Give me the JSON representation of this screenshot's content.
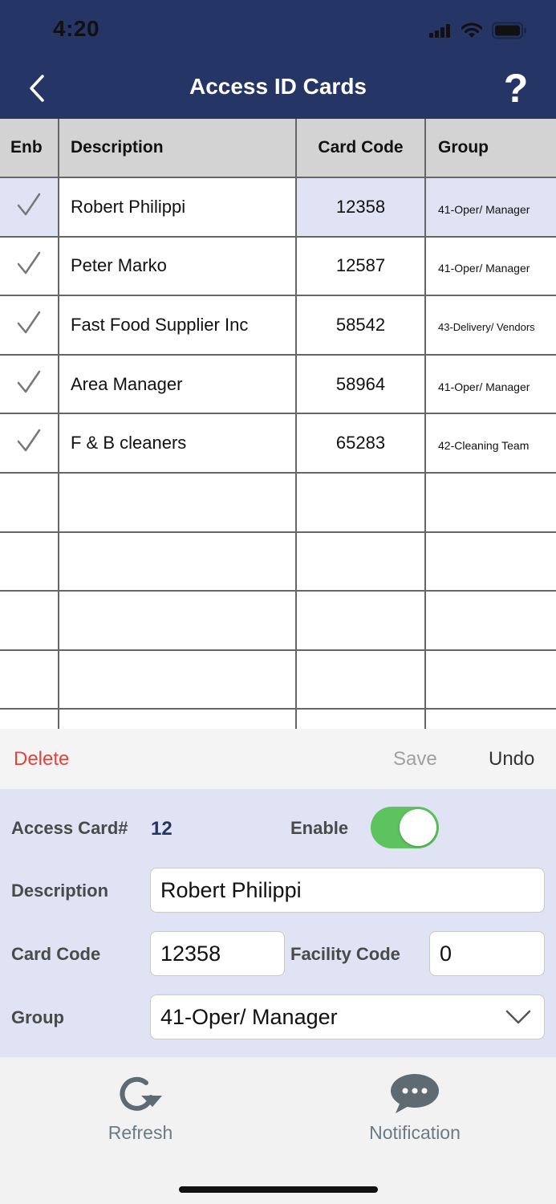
{
  "status_bar": {
    "time": "4:20"
  },
  "header": {
    "title": "Access ID Cards",
    "help_label": "?"
  },
  "table": {
    "columns": [
      "Enb",
      "Description",
      "Card Code",
      "Group"
    ],
    "rows": [
      {
        "enabled": "✓",
        "description": "Robert Philippi",
        "card_code": "12358",
        "group": "41-Oper/ Manager"
      },
      {
        "enabled": "✓",
        "description": "Peter Marko",
        "card_code": "12587",
        "group": "41-Oper/ Manager"
      },
      {
        "enabled": "✓",
        "description": "Fast Food Supplier Inc",
        "card_code": "58542",
        "group": "43-Delivery/ Vendors"
      },
      {
        "enabled": "✓",
        "description": "Area Manager",
        "card_code": "58964",
        "group": "41-Oper/ Manager"
      },
      {
        "enabled": "✓",
        "description": "F & B cleaners",
        "card_code": "65283",
        "group": "42-Cleaning Team"
      }
    ]
  },
  "actions": {
    "delete": "Delete",
    "save": "Save",
    "undo": "Undo"
  },
  "form": {
    "access_card_label": "Access Card#",
    "access_card_value": "12",
    "enable_label": "Enable",
    "enable_on": true,
    "description_label": "Description",
    "description_value": "Robert Philippi",
    "card_code_label": "Card Code",
    "card_code_value": "12358",
    "facility_code_label": "Facility Code",
    "facility_code_value": "0",
    "group_label": "Group",
    "group_value": "41-Oper/ Manager"
  },
  "tabbar": {
    "refresh": "Refresh",
    "notification": "Notification"
  },
  "colors": {
    "header": "#253566",
    "delete": "#e2443a",
    "toggle_on": "#5cc35f",
    "panel": "#dfe3f3"
  }
}
